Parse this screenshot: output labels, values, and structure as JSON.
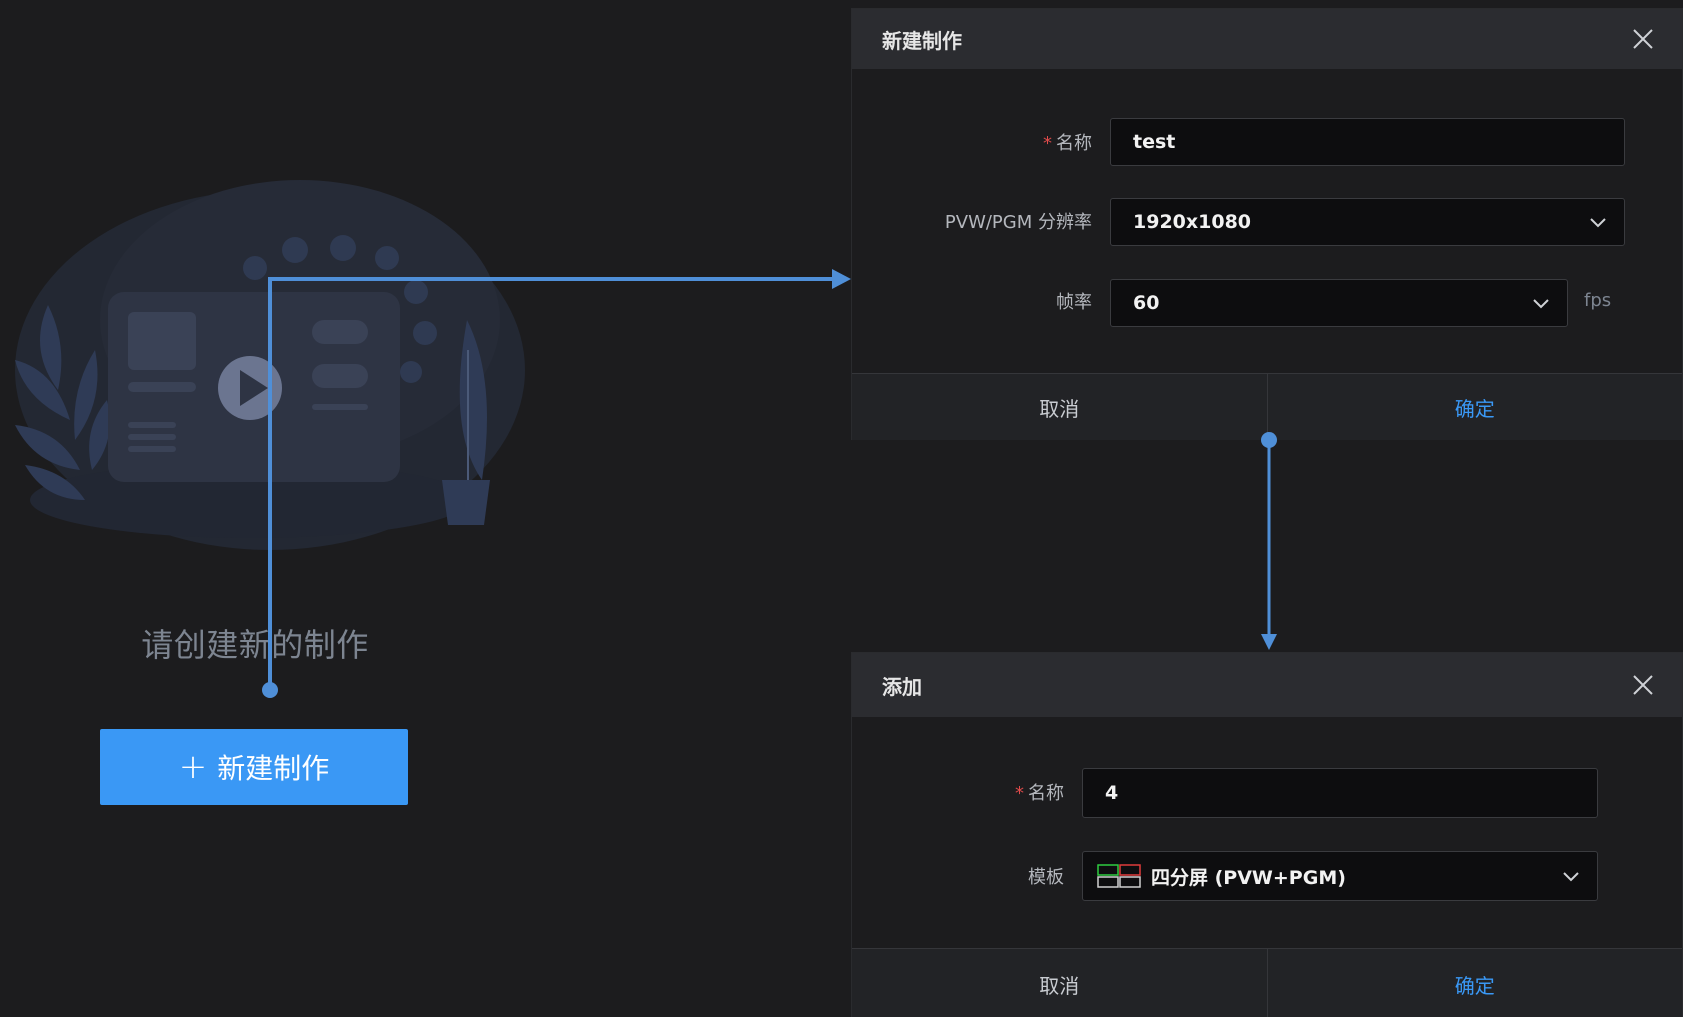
{
  "empty_state": {
    "message": "请创建新的制作",
    "new_button_label": "新建制作",
    "new_button_icon": "plus-icon"
  },
  "dialog_new_production": {
    "title": "新建制作",
    "close_icon": "close-icon",
    "name_label": "名称",
    "name_value": "test",
    "resolution_label": "PVW/PGM 分辨率",
    "resolution_value": "1920x1080",
    "framerate_label": "帧率",
    "framerate_value": "60",
    "framerate_suffix": "fps",
    "cancel_label": "取消",
    "ok_label": "确定"
  },
  "dialog_add": {
    "title": "添加",
    "close_icon": "close-icon",
    "name_label": "名称",
    "name_value": "4",
    "template_label": "模板",
    "template_value": "四分屏 (PVW+PGM)",
    "template_icon": "quad-layout-icon",
    "cancel_label": "取消",
    "ok_label": "确定"
  },
  "colors": {
    "accent": "#3a98f5",
    "background": "#1c1c1e",
    "required_marker": "#e04b4b",
    "arrow": "#4f8fd8"
  }
}
